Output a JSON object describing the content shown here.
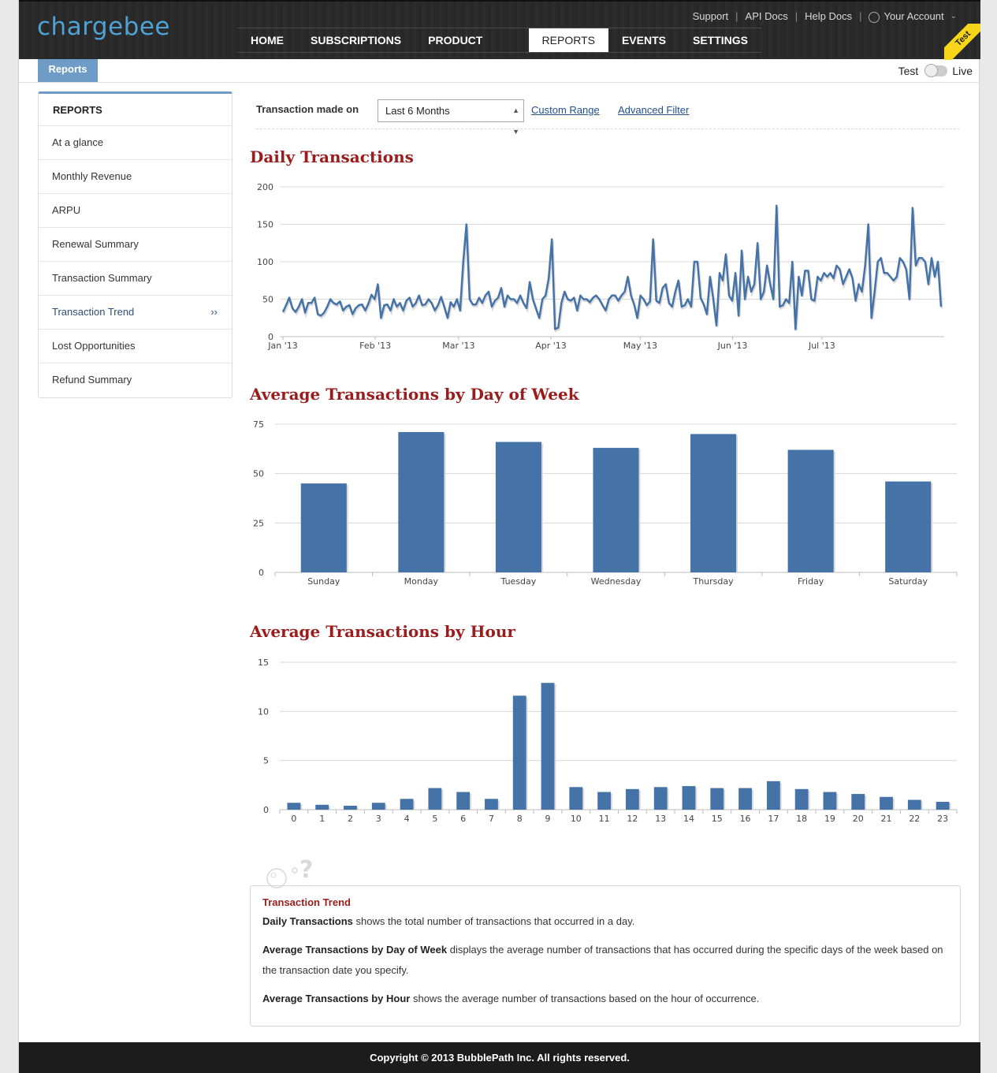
{
  "header": {
    "logo": "chargebee",
    "links": {
      "support": "Support",
      "api_docs": "API Docs",
      "help_docs": "Help Docs",
      "account": "Your Account"
    },
    "nav": [
      "HOME",
      "SUBSCRIPTIONS",
      "PRODUCT CONFIG",
      "REPORTS",
      "EVENTS",
      "SETTINGS"
    ],
    "active_nav": "REPORTS",
    "ribbon": "Test"
  },
  "subbar": {
    "tab": "Reports",
    "mode_test": "Test",
    "mode_live": "Live",
    "mode_selected": "Test"
  },
  "sidebar": {
    "heading": "REPORTS",
    "items": [
      "At a glance",
      "Monthly Revenue",
      "ARPU",
      "Renewal Summary",
      "Transaction Summary",
      "Transaction Trend",
      "Lost Opportunities",
      "Refund Summary"
    ],
    "active": "Transaction Trend",
    "active_arrow": "››"
  },
  "filter": {
    "label": "Transaction made on",
    "selected": "Last 6 Months",
    "custom_range": "Custom Range",
    "advanced_filter": "Advanced Filter"
  },
  "charts": {
    "daily": {
      "title": "Daily Transactions"
    },
    "weekday": {
      "title": "Average Transactions by Day of Week"
    },
    "hourly": {
      "title": "Average Transactions by Hour"
    }
  },
  "chart_data": [
    {
      "type": "line",
      "title": "Daily Transactions",
      "x_tick_labels": [
        "Jan '13",
        "Feb '13",
        "Mar '13",
        "Apr '13",
        "May '13",
        "Jun '13",
        "Jul '13"
      ],
      "x_range": [
        "2013-01-01",
        "2013-08-10"
      ],
      "ylim": [
        0,
        200
      ],
      "y_ticks": [
        0,
        50,
        100,
        150,
        200
      ],
      "grid": true,
      "color": "#4573a7",
      "series": [
        {
          "values": [
            33,
            42,
            52,
            38,
            33,
            40,
            50,
            32,
            45,
            45,
            52,
            30,
            28,
            32,
            40,
            50,
            45,
            43,
            47,
            35,
            40,
            42,
            30,
            38,
            42,
            43,
            35,
            44,
            56,
            50,
            70,
            25,
            42,
            43,
            35,
            50,
            40,
            45,
            35,
            48,
            52,
            40,
            45,
            55,
            42,
            43,
            50,
            45,
            35,
            42,
            53,
            40,
            25,
            46,
            40,
            50,
            35,
            100,
            150,
            50,
            43,
            43,
            52,
            45,
            55,
            60,
            40,
            48,
            52,
            65,
            40,
            55,
            50,
            50,
            45,
            55,
            45,
            38,
            73,
            50,
            37,
            25,
            50,
            55,
            78,
            130,
            10,
            12,
            45,
            60,
            50,
            48,
            52,
            35,
            55,
            50,
            50,
            46,
            52,
            55,
            50,
            42,
            35,
            50,
            55,
            55,
            48,
            55,
            60,
            80,
            55,
            43,
            25,
            55,
            50,
            42,
            47,
            130,
            48,
            45,
            65,
            70,
            45,
            40,
            60,
            75,
            40,
            42,
            50,
            40,
            100,
            100,
            52,
            43,
            30,
            80,
            50,
            15,
            85,
            75,
            110,
            55,
            48,
            85,
            28,
            115,
            50,
            80,
            60,
            70,
            125,
            50,
            60,
            95,
            70,
            50,
            175,
            40,
            42,
            50,
            45,
            100,
            10,
            80,
            55,
            88,
            88,
            50,
            48,
            80,
            75,
            85,
            80,
            85,
            78,
            95,
            90,
            70,
            80,
            90,
            78,
            48,
            70,
            60,
            95,
            150,
            25,
            60,
            100,
            105,
            85,
            85,
            80,
            75,
            80,
            105,
            100,
            90,
            50,
            172,
            95,
            105,
            105,
            100,
            70,
            105,
            80,
            100,
            40
          ]
        }
      ]
    },
    {
      "type": "bar",
      "title": "Average Transactions by Day of Week",
      "categories": [
        "Sunday",
        "Monday",
        "Tuesday",
        "Wednesday",
        "Thursday",
        "Friday",
        "Saturday"
      ],
      "values": [
        45,
        71,
        66,
        63,
        70,
        62,
        46
      ],
      "ylim": [
        0,
        75
      ],
      "y_ticks": [
        0,
        25,
        50,
        75
      ],
      "grid": true,
      "color": "#4573a7"
    },
    {
      "type": "bar",
      "title": "Average Transactions by Hour",
      "categories": [
        "0",
        "1",
        "2",
        "3",
        "4",
        "5",
        "6",
        "7",
        "8",
        "9",
        "10",
        "11",
        "12",
        "13",
        "14",
        "15",
        "16",
        "17",
        "18",
        "19",
        "20",
        "21",
        "22",
        "23"
      ],
      "values": [
        0.7,
        0.5,
        0.4,
        0.7,
        1.1,
        2.2,
        1.8,
        1.1,
        11.6,
        12.9,
        2.3,
        1.8,
        2.1,
        2.3,
        2.4,
        2.2,
        2.2,
        2.9,
        2.1,
        1.8,
        1.6,
        1.3,
        1.0,
        0.8
      ],
      "ylim": [
        0,
        15
      ],
      "y_ticks": [
        0,
        5,
        10,
        15
      ],
      "grid": true,
      "color": "#4573a7"
    }
  ],
  "help": {
    "heading": "Transaction Trend",
    "p1_bold": "Daily Transactions",
    "p1": " shows the total number of transactions that occurred in a day.",
    "p2_bold": "Average Transactions by Day of Week",
    "p2": " displays the average number of transactions that has occurred during the specific days of the week based on the transaction date you specify.",
    "p3_bold": "Average Transactions by Hour",
    "p3": " shows the average number of transactions based on the hour of occurrence."
  },
  "footer": "Copyright © 2013 BubblePath Inc. All rights reserved."
}
